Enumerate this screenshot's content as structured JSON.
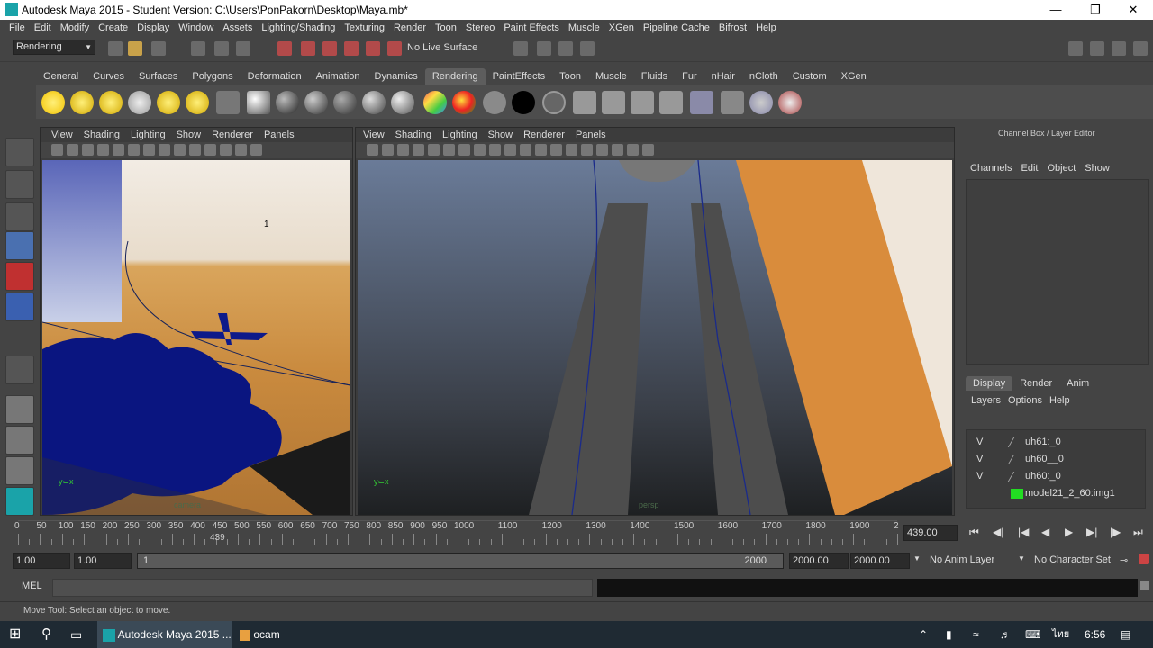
{
  "window": {
    "title": "Autodesk Maya 2015 - Student Version: C:\\Users\\PonPakorn\\Desktop\\Maya.mb*"
  },
  "menu": [
    "File",
    "Edit",
    "Modify",
    "Create",
    "Display",
    "Window",
    "Assets",
    "Lighting/Shading",
    "Texturing",
    "Render",
    "Toon",
    "Stereo",
    "Paint Effects",
    "Muscle",
    "XGen",
    "Pipeline Cache",
    "Bifrost",
    "Help"
  ],
  "status": {
    "mode": "Rendering",
    "live_surface": "No Live Surface"
  },
  "shelf_tabs": [
    "General",
    "Curves",
    "Surfaces",
    "Polygons",
    "Deformation",
    "Animation",
    "Dynamics",
    "Rendering",
    "PaintEffects",
    "Toon",
    "Muscle",
    "Fluids",
    "Fur",
    "nHair",
    "nCloth",
    "Custom",
    "XGen"
  ],
  "shelf_active": "Rendering",
  "panel_menu": [
    "View",
    "Shading",
    "Lighting",
    "Show",
    "Renderer",
    "Panels"
  ],
  "viewport_left": {
    "label_num": "1",
    "camera_label": "camera"
  },
  "viewport_right": {
    "camera_label": "persp"
  },
  "channel_box": {
    "title": "Channel Box / Layer Editor",
    "menu": [
      "Channels",
      "Edit",
      "Object",
      "Show"
    ],
    "tabs": [
      "Display",
      "Render",
      "Anim"
    ],
    "active_tab": "Display",
    "layer_menu": [
      "Layers",
      "Options",
      "Help"
    ],
    "layers": [
      {
        "v": "V",
        "name": "uh61:_0"
      },
      {
        "v": "V",
        "name": "uh60__0"
      },
      {
        "v": "V",
        "name": "uh60:_0"
      },
      {
        "v": "",
        "name": "model21_2_60:img1"
      }
    ]
  },
  "timeline": {
    "ticks": [
      "0",
      "50",
      "100",
      "150",
      "200",
      "250",
      "300",
      "350",
      "400",
      "450",
      "500",
      "550",
      "600",
      "650",
      "700",
      "750",
      "800",
      "850",
      "900",
      "950",
      "1000",
      "1100",
      "1200",
      "1300",
      "1400",
      "1500",
      "1600",
      "1700",
      "1800",
      "1900",
      "2"
    ],
    "current_marker": "439",
    "current_field": "439.00"
  },
  "range": {
    "start": "1.00",
    "start2": "1.00",
    "slider_start": "1",
    "slider_end": "2000",
    "end": "2000.00",
    "end2": "2000.00",
    "anim_layer": "No Anim Layer",
    "character_set": "No Character Set"
  },
  "mel": {
    "label": "MEL"
  },
  "help_line": "Move Tool: Select an object to move.",
  "taskbar": {
    "maya_item": "Autodesk Maya 2015 ...",
    "ocam_item": "ocam",
    "lang": "ไทย",
    "time": "6:56"
  }
}
